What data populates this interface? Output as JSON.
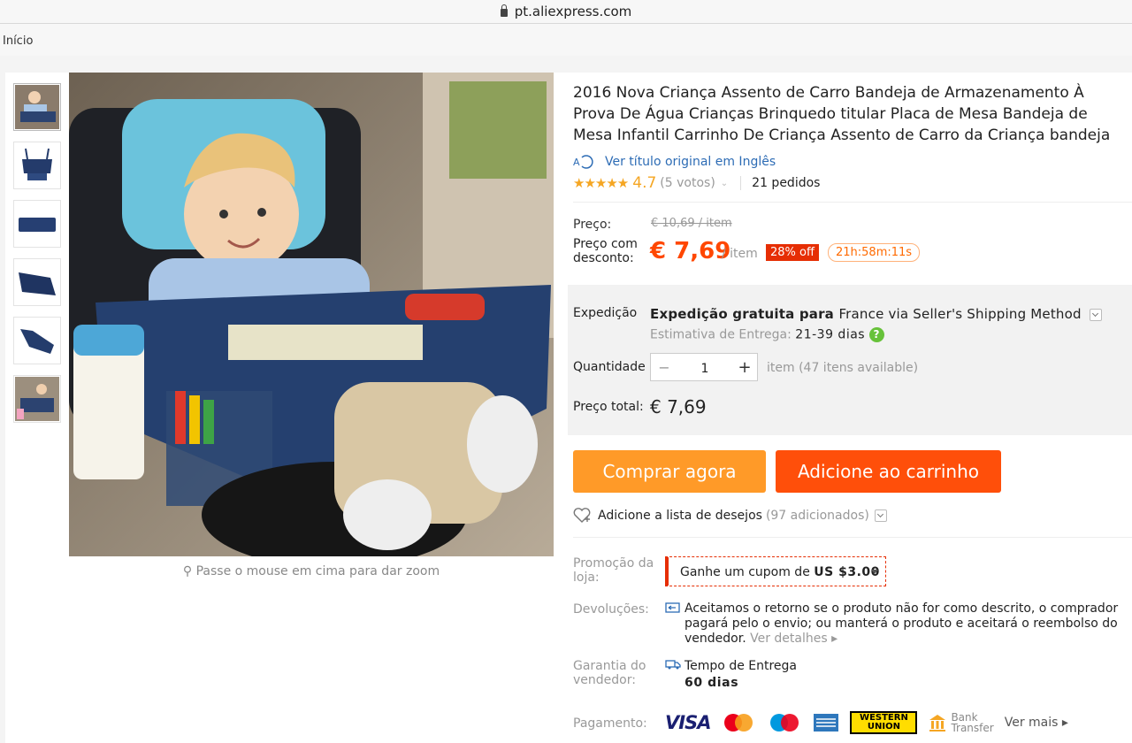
{
  "browser": {
    "url": "pt.aliexpress.com"
  },
  "breadcrumb": {
    "home": "Início"
  },
  "gallery": {
    "zoom_hint": "Passe o mouse em cima para dar zoom"
  },
  "product": {
    "title": "2016 Nova Criança Assento de Carro Bandeja de Armazenamento À Prova De Água Crianças Brinquedo titular Placa de Mesa Bandeja de Mesa Infantil Carrinho De Criança Assento de Carro da Criança bandeja",
    "translate_link": "Ver título original em Inglês",
    "stars": "★★★★★",
    "rating": "4.7",
    "votes": "(5 votos)",
    "orders": "21 pedidos"
  },
  "price": {
    "label": "Preço:",
    "old": "€ 10,69 / item",
    "discount_label": "Preço com desconto:",
    "current": "€ 7,69",
    "per": "/ item",
    "off_badge": "28% off",
    "timer": "21h:58m:11s"
  },
  "shipping": {
    "label": "Expedição",
    "bold": "Expedição gratuita para",
    "country": "France via Seller's Shipping Method",
    "eta_label": "Estimativa de Entrega:",
    "eta_value": "21-39 dias",
    "help": "?"
  },
  "quantity": {
    "label": "Quantidade",
    "minus": "−",
    "value": "1",
    "plus": "+",
    "note": "item (47 itens available)"
  },
  "total": {
    "label": "Preço total:",
    "value": "€ 7,69"
  },
  "buttons": {
    "buy": "Comprar agora",
    "cart": "Adicione ao carrinho"
  },
  "wishlist": {
    "label": "Adicione a lista de desejos",
    "count": "(97 adicionados)"
  },
  "promo": {
    "label": "Promoção da loja:",
    "coupon_text": "Ganhe um cupom de",
    "coupon_value": "US $3.00"
  },
  "returns": {
    "label": "Devoluções:",
    "text": "Aceitamos o retorno se o produto não for como descrito, o comprador pagará pelo o envio; ou manterá o produto e aceitará o reembolso do vendedor.",
    "more": "Ver detalhes ▸"
  },
  "guarantee": {
    "label": "Garantia do vendedor:",
    "title": "Tempo de Entrega",
    "value": "60 dias"
  },
  "payment": {
    "label": "Pagamento:",
    "visa": "VISA",
    "western_union": "WESTERN UNION",
    "bank_transfer_1": "Bank",
    "bank_transfer_2": "Transfer",
    "more": "Ver mais ▸"
  },
  "colors": {
    "accent_orange": "#ff4700",
    "buy_button": "#ff9a28",
    "cart_button": "#ff4f0a",
    "link_blue": "#2d6cb5"
  }
}
